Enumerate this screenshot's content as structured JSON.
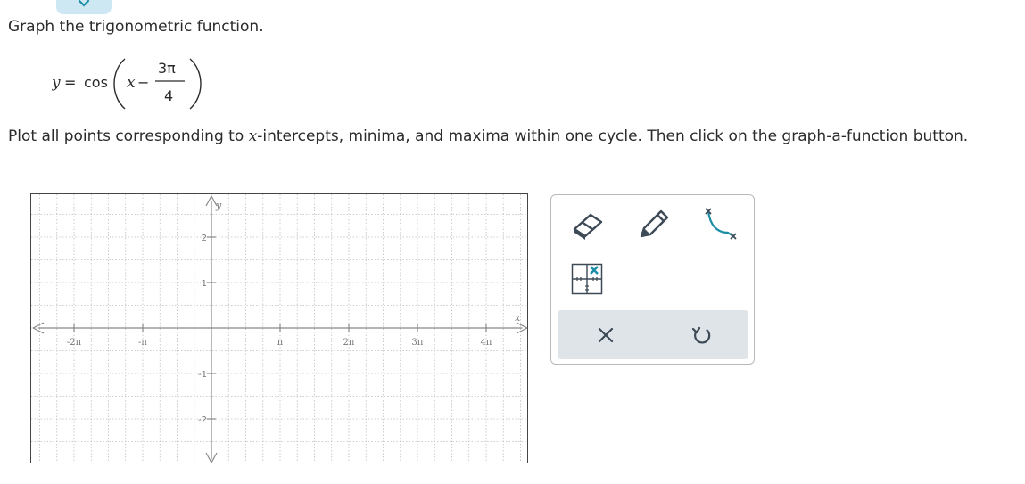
{
  "header": {
    "instruction": "Graph the trigonometric function.",
    "equation": {
      "lhs": "y",
      "equals": "=",
      "func": "cos",
      "var": "x",
      "minus": "−",
      "numerator": "3π",
      "denominator": "4"
    },
    "plot_instruction_before": "Plot all points corresponding to ",
    "plot_instruction_var": "x",
    "plot_instruction_after": "-intercepts, minima, and maxima within one cycle. Then click on the graph-a-function button."
  },
  "graph": {
    "x_axis_label": "x",
    "y_axis_label": "y",
    "x_tick_labels": [
      "-2π",
      "-π",
      "π",
      "2π",
      "3π",
      "4π"
    ],
    "y_tick_labels": [
      "2",
      "1",
      "-1",
      "-2"
    ]
  },
  "toolbox": {
    "tools": [
      {
        "name": "eraser-tool",
        "icon": "eraser-icon"
      },
      {
        "name": "pencil-tool",
        "icon": "pencil-icon"
      },
      {
        "name": "graph-a-function-tool",
        "icon": "curve-icon"
      },
      {
        "name": "graph-settings-tool",
        "icon": "grid-icon"
      }
    ],
    "actions": [
      {
        "name": "clear-button",
        "icon": "x-icon"
      },
      {
        "name": "undo-button",
        "icon": "undo-icon"
      }
    ],
    "colors": {
      "accent": "#1b8ea6",
      "icon": "#3d4a56",
      "action_bg": "#dfe4e8"
    }
  }
}
